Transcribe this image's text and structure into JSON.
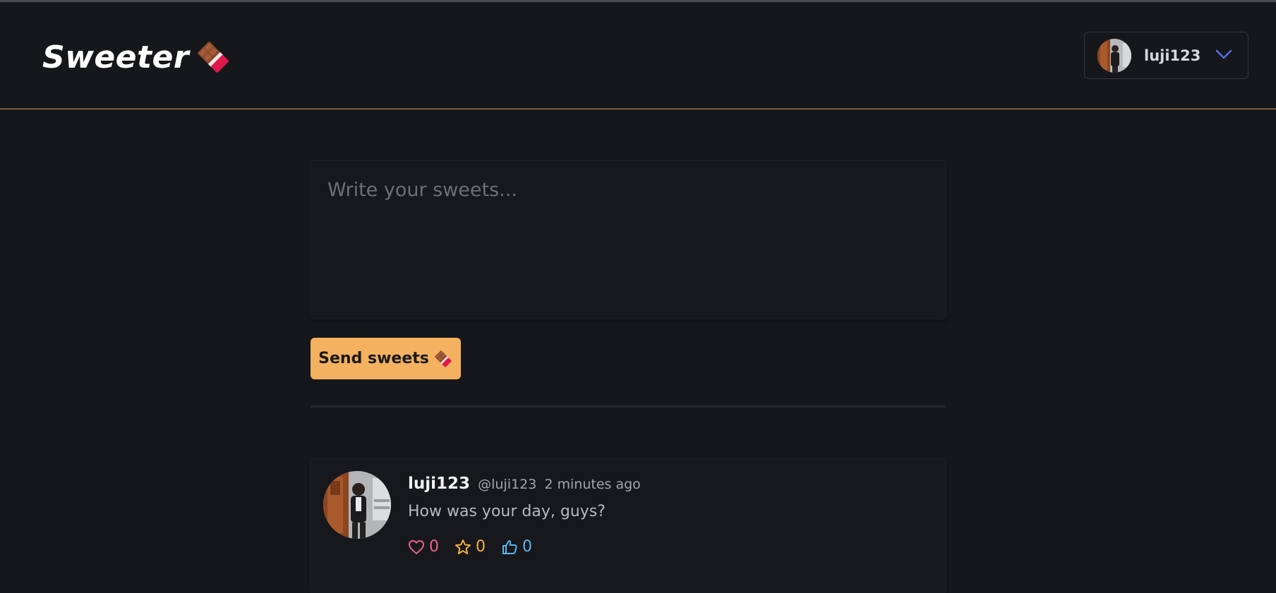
{
  "header": {
    "logo_text": "Sweeter",
    "logo_icon": "chocolate-bar-icon",
    "user_menu": {
      "username": "luji123",
      "avatar_icon": "user-avatar",
      "chevron_icon": "chevron-down-icon"
    }
  },
  "composer": {
    "placeholder": "Write your sweets...",
    "value": ""
  },
  "send_button": {
    "label": "Send sweets",
    "icon": "chocolate-bar-icon"
  },
  "feed": {
    "sweets": [
      {
        "name": "luji123",
        "handle": "@luji123",
        "time": "2 minutes ago",
        "body": "How was your day, guys?",
        "likes": "0",
        "stars": "0",
        "thumbs": "0"
      }
    ]
  },
  "colors": {
    "background": "#16171b",
    "accent": "#f4b160",
    "header_border": "#c9a35a",
    "like": "#f0628a",
    "star": "#f2b13f",
    "thumb": "#5ab6f0",
    "chevron": "#5b6be8"
  }
}
